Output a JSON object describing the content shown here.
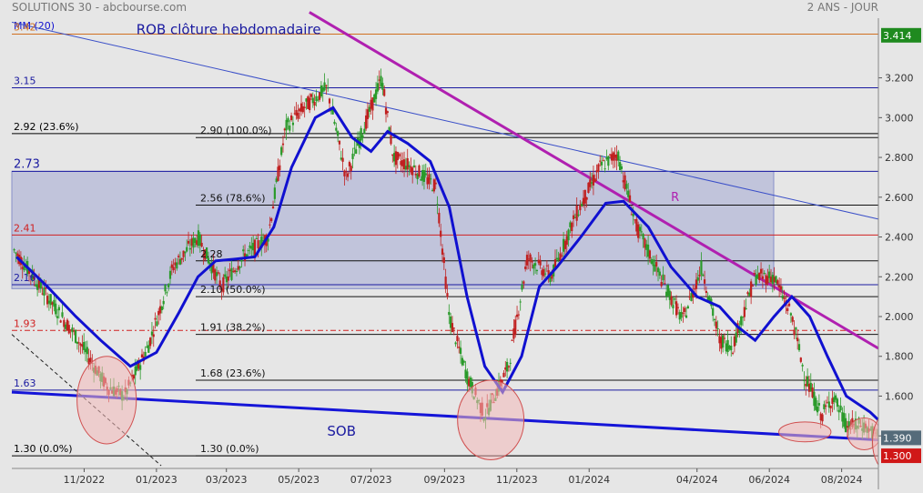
{
  "header": {
    "title": "SOLUTIONS 30 - abcbourse.com",
    "period": "2 ANS - JOUR"
  },
  "chart_data": {
    "type": "candlestick",
    "ylim": [
      1.25,
      3.5
    ],
    "y_ticks": [
      "3.200",
      "3.000",
      "2.800",
      "2.600",
      "2.400",
      "2.200",
      "2.000",
      "1.800",
      "1.600",
      "1.400"
    ],
    "y_tick_values": [
      3.2,
      3.0,
      2.8,
      2.6,
      2.4,
      2.2,
      2.0,
      1.8,
      1.6,
      1.4
    ],
    "x_ticks": [
      "11/2022",
      "01/2023",
      "03/2023",
      "05/2023",
      "07/2023",
      "09/2023",
      "11/2023",
      "01/2024",
      "04/2024",
      "06/2024",
      "08/2024"
    ],
    "x_tick_dates": [
      "2022-11-01",
      "2023-01-01",
      "2023-03-01",
      "2023-05-01",
      "2023-07-01",
      "2023-09-01",
      "2023-11-01",
      "2024-01-01",
      "2024-04-01",
      "2024-06-01",
      "2024-08-01"
    ],
    "x_range": [
      "2022-09-01",
      "2024-09-01"
    ],
    "last_price": "3.414",
    "price_badges": [
      "1.390",
      "1.300"
    ],
    "moving_average": {
      "name": "MM (20)",
      "color": "#1010d0",
      "points": [
        [
          "2022-09-05",
          2.3
        ],
        [
          "2022-10-01",
          2.15
        ],
        [
          "2022-10-25",
          2.0
        ],
        [
          "2022-11-15",
          1.88
        ],
        [
          "2022-12-10",
          1.75
        ],
        [
          "2023-01-01",
          1.82
        ],
        [
          "2023-01-20",
          2.02
        ],
        [
          "2023-02-05",
          2.2
        ],
        [
          "2023-02-20",
          2.28
        ],
        [
          "2023-03-10",
          2.29
        ],
        [
          "2023-03-25",
          2.3
        ],
        [
          "2023-04-10",
          2.45
        ],
        [
          "2023-04-25",
          2.75
        ],
        [
          "2023-05-15",
          3.0
        ],
        [
          "2023-05-30",
          3.05
        ],
        [
          "2023-06-15",
          2.9
        ],
        [
          "2023-07-01",
          2.83
        ],
        [
          "2023-07-15",
          2.93
        ],
        [
          "2023-08-01",
          2.87
        ],
        [
          "2023-08-20",
          2.78
        ],
        [
          "2023-09-05",
          2.55
        ],
        [
          "2023-09-20",
          2.1
        ],
        [
          "2023-10-05",
          1.75
        ],
        [
          "2023-10-20",
          1.62
        ],
        [
          "2023-11-05",
          1.8
        ],
        [
          "2023-11-20",
          2.15
        ],
        [
          "2023-12-05",
          2.25
        ],
        [
          "2023-12-25",
          2.4
        ],
        [
          "2024-01-15",
          2.57
        ],
        [
          "2024-01-30",
          2.58
        ],
        [
          "2024-02-20",
          2.45
        ],
        [
          "2024-03-10",
          2.25
        ],
        [
          "2024-04-01",
          2.1
        ],
        [
          "2024-04-20",
          2.05
        ],
        [
          "2024-05-05",
          1.95
        ],
        [
          "2024-05-20",
          1.88
        ],
        [
          "2024-06-05",
          2.0
        ],
        [
          "2024-06-20",
          2.1
        ],
        [
          "2024-07-05",
          2.0
        ],
        [
          "2024-07-20",
          1.8
        ],
        [
          "2024-08-05",
          1.6
        ],
        [
          "2024-08-25",
          1.52
        ],
        [
          "2024-09-01",
          1.48
        ]
      ]
    },
    "candles_key": [
      [
        "2022-09-01",
        2.35
      ],
      [
        "2022-10-01",
        2.1
      ],
      [
        "2022-10-25",
        1.9
      ],
      [
        "2022-11-20",
        1.65
      ],
      [
        "2022-12-05",
        1.6
      ],
      [
        "2022-12-25",
        1.85
      ],
      [
        "2023-01-15",
        2.25
      ],
      [
        "2023-02-05",
        2.4
      ],
      [
        "2023-02-25",
        2.15
      ],
      [
        "2023-03-15",
        2.3
      ],
      [
        "2023-04-05",
        2.4
      ],
      [
        "2023-04-20",
        2.95
      ],
      [
        "2023-05-05",
        3.05
      ],
      [
        "2023-05-25",
        3.15
      ],
      [
        "2023-06-10",
        2.7
      ],
      [
        "2023-06-25",
        2.95
      ],
      [
        "2023-07-10",
        3.2
      ],
      [
        "2023-07-20",
        2.8
      ],
      [
        "2023-08-05",
        2.75
      ],
      [
        "2023-08-25",
        2.65
      ],
      [
        "2023-09-05",
        2.0
      ],
      [
        "2023-09-20",
        1.7
      ],
      [
        "2023-10-05",
        1.5
      ],
      [
        "2023-10-25",
        1.75
      ],
      [
        "2023-11-10",
        2.3
      ],
      [
        "2023-11-30",
        2.2
      ],
      [
        "2023-12-20",
        2.5
      ],
      [
        "2024-01-10",
        2.75
      ],
      [
        "2024-01-25",
        2.82
      ],
      [
        "2024-02-10",
        2.45
      ],
      [
        "2024-03-01",
        2.2
      ],
      [
        "2024-03-20",
        1.98
      ],
      [
        "2024-04-05",
        2.25
      ],
      [
        "2024-04-20",
        1.88
      ],
      [
        "2024-05-01",
        1.85
      ],
      [
        "2024-05-20",
        2.2
      ],
      [
        "2024-06-05",
        2.2
      ],
      [
        "2024-06-20",
        2.0
      ],
      [
        "2024-07-01",
        1.7
      ],
      [
        "2024-07-15",
        1.5
      ],
      [
        "2024-07-25",
        1.6
      ],
      [
        "2024-08-05",
        1.45
      ],
      [
        "2024-08-20",
        1.45
      ],
      [
        "2024-09-01",
        1.39
      ]
    ],
    "horizontal_levels": [
      {
        "value": 3.42,
        "label": "3.42",
        "color": "#d07020"
      },
      {
        "value": 3.15,
        "label": "3.15",
        "color": "#1a1aa0"
      },
      {
        "value": 2.92,
        "label": "2.92  (23.6%)",
        "color": "#000000"
      },
      {
        "value": 2.73,
        "label": "2.73",
        "color": "#1a1aa0"
      },
      {
        "value": 2.41,
        "label": "2.41",
        "color": "#d02020"
      },
      {
        "value": 2.16,
        "label": "2.16",
        "color": "#1a1aa0"
      },
      {
        "value": 1.93,
        "label": "1.93",
        "color": "#d02020"
      },
      {
        "value": 1.63,
        "label": "1.63",
        "color": "#1a1aa0"
      },
      {
        "value": 1.3,
        "label": "1.30  (0.0%)",
        "color": "#000000"
      }
    ],
    "fibo_levels": [
      {
        "value": 2.9,
        "label": "2.90  (100.0%)"
      },
      {
        "value": 2.56,
        "label": "2.56  (78.6%)"
      },
      {
        "value": 2.28,
        "label": "2.28"
      },
      {
        "value": 2.1,
        "label": "2.10  (50.0%)"
      },
      {
        "value": 1.91,
        "label": "1.91  (38.2%)"
      },
      {
        "value": 1.68,
        "label": "1.68  (23.6%)"
      },
      {
        "value": 1.3,
        "label": "1.30  (0.0%)"
      }
    ],
    "zone": {
      "from": 2.14,
      "to": 2.73,
      "color": "#b8bcd8"
    },
    "trendlines": [
      {
        "name": "weekly-resistance",
        "color": "#3a4fc8",
        "points": [
          [
            "2022-09-01",
            3.48
          ],
          [
            "2024-09-01",
            2.49
          ]
        ]
      },
      {
        "name": "resistance-r",
        "color": "#b020b0",
        "points": [
          [
            "2023-05-10",
            3.53
          ],
          [
            "2024-09-01",
            1.84
          ]
        ]
      },
      {
        "name": "support-sob",
        "color": "#1515d8",
        "points": [
          [
            "2022-09-01",
            1.62
          ],
          [
            "2024-09-01",
            1.38
          ]
        ]
      },
      {
        "name": "dashed-support",
        "color": "#202020",
        "points": [
          [
            "2022-09-01",
            1.91
          ],
          [
            "2023-01-05",
            1.25
          ]
        ]
      }
    ],
    "annotations": [
      {
        "text": "ROB clôture hebdomadaire",
        "color": "#1a1aa0",
        "at": [
          "2022-12-15",
          3.42
        ]
      },
      {
        "text": "R",
        "color": "#b020b0",
        "at": [
          "2024-03-10",
          2.58
        ]
      },
      {
        "text": "SOB",
        "color": "#1a1aa0",
        "at": [
          "2023-05-25",
          1.4
        ]
      }
    ],
    "ellipses": [
      {
        "center": [
          "2022-11-20",
          1.58
        ],
        "rx_days": 25,
        "ry": 0.22
      },
      {
        "center": [
          "2023-10-10",
          1.48
        ],
        "rx_days": 28,
        "ry": 0.2
      },
      {
        "center": [
          "2024-07-01",
          1.42
        ],
        "rx_days": 22,
        "ry": 0.05
      },
      {
        "center": [
          "2024-08-20",
          1.41
        ],
        "rx_days": 14,
        "ry": 0.08
      },
      {
        "center": [
          "2024-09-10",
          1.37
        ],
        "rx_days": 14,
        "ry": 0.15
      }
    ]
  }
}
